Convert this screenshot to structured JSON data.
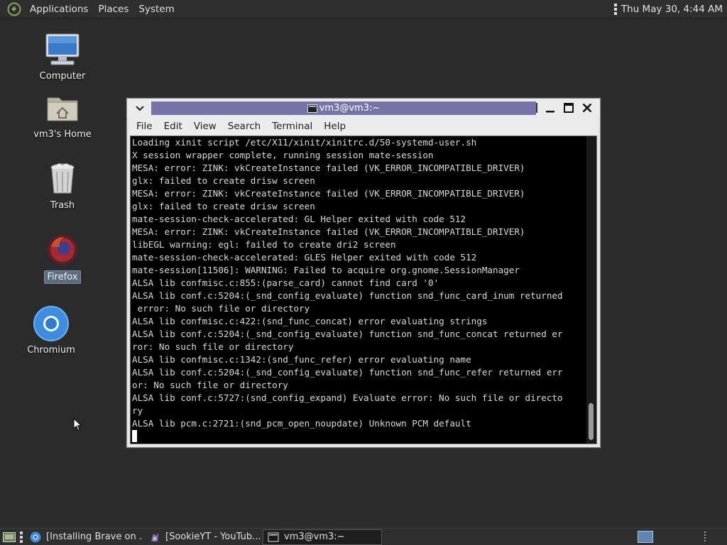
{
  "top_panel": {
    "menus": [
      "Applications",
      "Places",
      "System"
    ],
    "clock": "Thu May 30,  4:44 AM"
  },
  "desktop_icons": [
    {
      "label": "Computer",
      "icon": "computer-icon"
    },
    {
      "label": "vm3's Home",
      "icon": "home-folder-icon"
    },
    {
      "label": "Trash",
      "icon": "trash-icon"
    },
    {
      "label": "Firefox",
      "icon": "firefox-icon"
    },
    {
      "label": "Chromium",
      "icon": "chromium-icon"
    }
  ],
  "terminal": {
    "title": "vm3@vm3:~",
    "menus": [
      "File",
      "Edit",
      "View",
      "Search",
      "Terminal",
      "Help"
    ],
    "lines": [
      "Loading xinit script /etc/X11/xinit/xinitrc.d/50-systemd-user.sh",
      "X session wrapper complete, running session mate-session",
      "MESA: error: ZINK: vkCreateInstance failed (VK_ERROR_INCOMPATIBLE_DRIVER)",
      "glx: failed to create drisw screen",
      "MESA: error: ZINK: vkCreateInstance failed (VK_ERROR_INCOMPATIBLE_DRIVER)",
      "glx: failed to create drisw screen",
      "mate-session-check-accelerated: GL Helper exited with code 512",
      "MESA: error: ZINK: vkCreateInstance failed (VK_ERROR_INCOMPATIBLE_DRIVER)",
      "libEGL warning: egl: failed to create dri2 screen",
      "mate-session-check-accelerated: GLES Helper exited with code 512",
      "mate-session[11506]: WARNING: Failed to acquire org.gnome.SessionManager",
      "ALSA lib confmisc.c:855:(parse_card) cannot find card '0'",
      "ALSA lib conf.c:5204:(_snd_config_evaluate) function snd_func_card_inum returned",
      " error: No such file or directory",
      "ALSA lib confmisc.c:422:(snd_func_concat) error evaluating strings",
      "ALSA lib conf.c:5204:(_snd_config_evaluate) function snd_func_concat returned er",
      "ror: No such file or directory",
      "ALSA lib confmisc.c:1342:(snd_func_refer) error evaluating name",
      "ALSA lib conf.c:5204:(_snd_config_evaluate) function snd_func_refer returned err",
      "or: No such file or directory",
      "ALSA lib conf.c:5727:(snd_config_expand) Evaluate error: No such file or directo",
      "ry",
      "ALSA lib pcm.c:2721:(snd_pcm_open_noupdate) Unknown PCM default"
    ]
  },
  "taskbar": {
    "tasks": [
      {
        "label": "[Installing Brave on ...",
        "icon": "chromium-icon",
        "active": false
      },
      {
        "label": "[SookieYT - YouTub...",
        "icon": "sookie-icon",
        "active": false
      },
      {
        "label": "vm3@vm3:~",
        "icon": "terminal-icon",
        "active": true
      }
    ]
  },
  "colors": {
    "title_strip": "#7474a8",
    "desktop_bg": "#2b2b2b",
    "panel_bg": "#2f2f2f",
    "terminal_bg": "#000000"
  }
}
